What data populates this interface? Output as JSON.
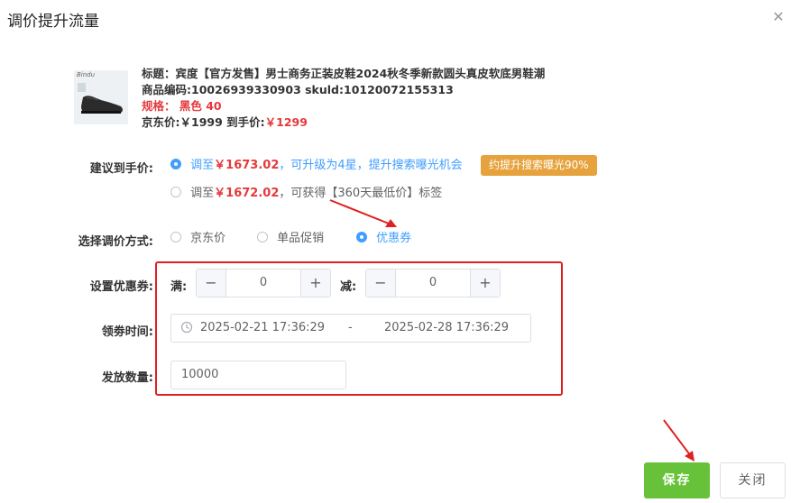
{
  "dialog": {
    "title": "调价提升流量"
  },
  "product": {
    "title_line": "标题：宾度【官方发售】男士商务正装皮鞋2024秋冬季新款圆头真皮软底男鞋潮",
    "code_line": "商品编码:10026939330903  skuld:10120072155313",
    "spec_label": "规格：",
    "spec_value": "黑色 40",
    "jd_price_line": "京东价:￥1999  到手价:",
    "final_price": "￥1299",
    "thumb_brand": "Bindu"
  },
  "suggest": {
    "label": "建议到手价:",
    "opt1_prefix": "调至",
    "opt1_price": "￥1673.02",
    "opt1_suffix": "，可升级为4星，提升搜索曝光机会",
    "opt1_badge": "约提升搜索曝光90%",
    "opt2_prefix": "调至",
    "opt2_price": "￥1672.02",
    "opt2_suffix": "，可获得【360天最低价】标签"
  },
  "method": {
    "label": "选择调价方式:",
    "options": [
      "京东价",
      "单品促销",
      "优惠券"
    ],
    "selected": "优惠券"
  },
  "coupon": {
    "label": "设置优惠券:",
    "full_label": "满:",
    "full_value": "0",
    "minus_label": "减:",
    "minus_value": "0"
  },
  "time": {
    "label": "领劵时间:",
    "start": "2025-02-21 17:36:29",
    "sep": "-",
    "end": "2025-02-28 17:36:29"
  },
  "quantity": {
    "label": "发放数量:",
    "value": "10000"
  },
  "footer": {
    "save": "保存",
    "close": "关闭"
  },
  "colors": {
    "accent": "#409eff",
    "price_red": "#e4393c",
    "badge": "#e6a23c",
    "save_green": "#67c23a",
    "frame_red": "#e02020"
  }
}
